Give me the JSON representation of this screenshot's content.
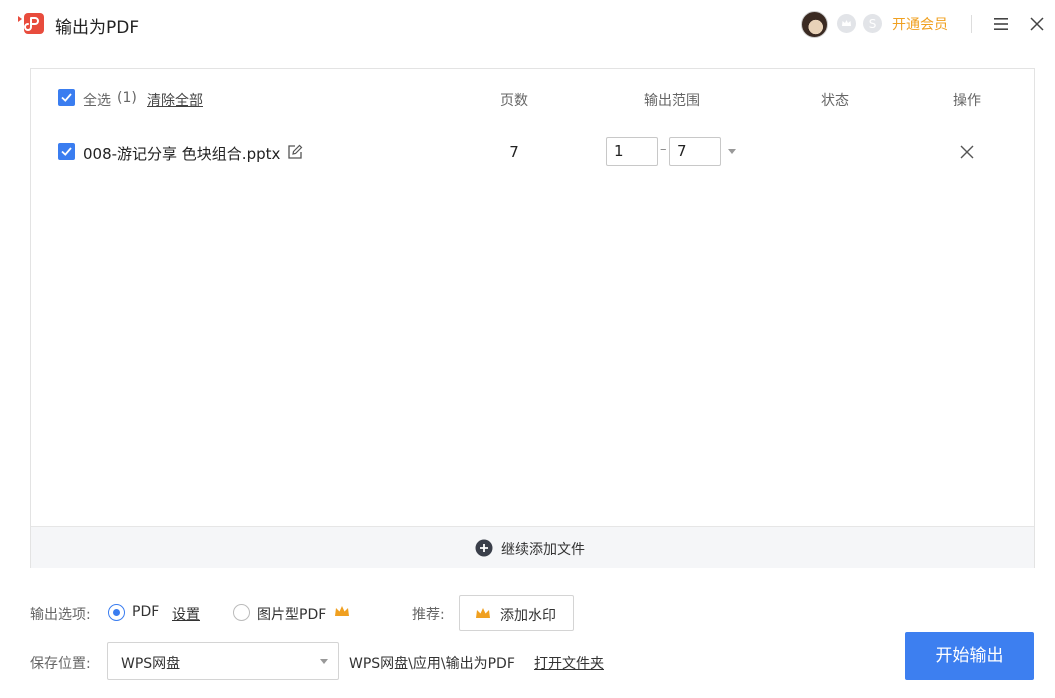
{
  "window": {
    "title": "输出为PDF",
    "vip_label": "开通会员"
  },
  "colors": {
    "accent": "#3d7ff0",
    "vip": "#f0a020",
    "brand": "#e84c3d"
  },
  "file_list": {
    "select_all_label": "全选",
    "select_all_count": "(1)",
    "clear_all_label": "清除全部",
    "columns": {
      "pages": "页数",
      "range": "输出范围",
      "status": "状态",
      "action": "操作"
    },
    "rows": [
      {
        "checked": true,
        "filename": "008-游记分享 色块组合.pptx",
        "pages": "7",
        "range_from": "1",
        "range_sep": "–",
        "range_to": "7",
        "status": ""
      }
    ],
    "add_more_label": "继续添加文件"
  },
  "options": {
    "output_label": "输出选项:",
    "pdf_label": "PDF",
    "settings_label": "设置",
    "image_pdf_label": "图片型PDF",
    "recommend_label": "推荐:",
    "watermark_label": "添加水印",
    "save_label": "保存位置:",
    "save_location": "WPS网盘",
    "save_path": "WPS网盘\\应用\\输出为PDF",
    "open_folder_label": "打开文件夹",
    "start_label": "开始输出"
  }
}
